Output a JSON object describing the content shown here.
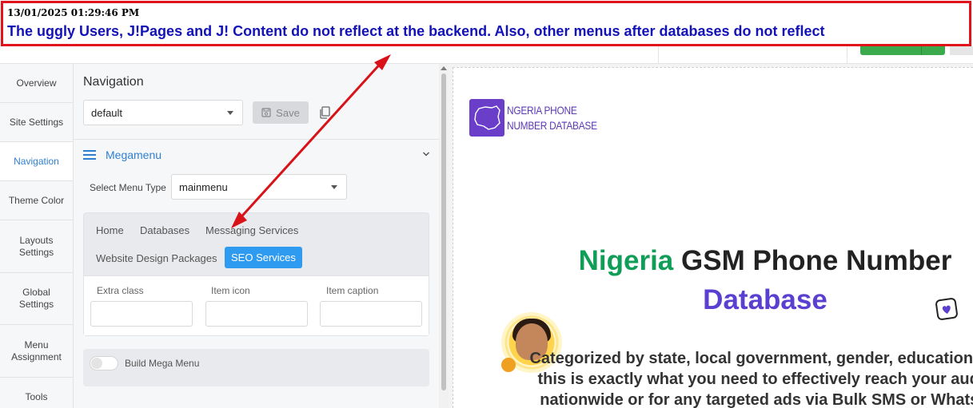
{
  "annotation": {
    "timestamp": "13/01/2025 01:29:46 PM",
    "message": "The uggly Users, J!Pages and J! Content do not reflect at the backend. Also, other menus after databases do not reflect"
  },
  "sidebar": {
    "items": [
      {
        "label": "Overview"
      },
      {
        "label": "Site Settings"
      },
      {
        "label": "Navigation"
      },
      {
        "label": "Theme Color"
      },
      {
        "label": "Layouts Settings"
      },
      {
        "label": "Global Settings"
      },
      {
        "label": "Menu Assignment"
      },
      {
        "label": "Tools"
      }
    ],
    "active_index": 2
  },
  "panel": {
    "title": "Navigation",
    "preset_value": "default",
    "save_label": "Save",
    "megamenu_label": "Megamenu",
    "menu_type_label": "Select Menu Type",
    "menu_type_value": "mainmenu",
    "menu_items": [
      "Home",
      "Databases",
      "Messaging Services",
      "Website Design Packages",
      "SEO Services"
    ],
    "active_menu_item": "SEO Services",
    "fields": {
      "extra_class": "Extra class",
      "item_icon": "Item icon",
      "item_caption": "Item caption"
    },
    "build_mega_menu_label": "Build Mega Menu",
    "build_mega_menu_on": false
  },
  "preview": {
    "logo_line1": "NGERIA PHONE",
    "logo_line2": "NUMBER DATABASE",
    "headline_green": "Nigeria",
    "headline_rest": "GSM Phone Number",
    "headline_line2": "Database",
    "sub_line1": "Categorized by state, local government, gender, education, an",
    "sub_line2": "this is exactly what you need to effectively reach your audie",
    "sub_line3": "nationwide or for any targeted ads via Bulk SMS or WhatsA"
  },
  "colors": {
    "annotation_border": "#e1121a",
    "annotation_text": "#1212b8",
    "accent_blue": "#2f7fd0",
    "seo_active": "#2f9bf0",
    "headline_green": "#0f9d58",
    "headline_purple": "#5b3fd1"
  }
}
